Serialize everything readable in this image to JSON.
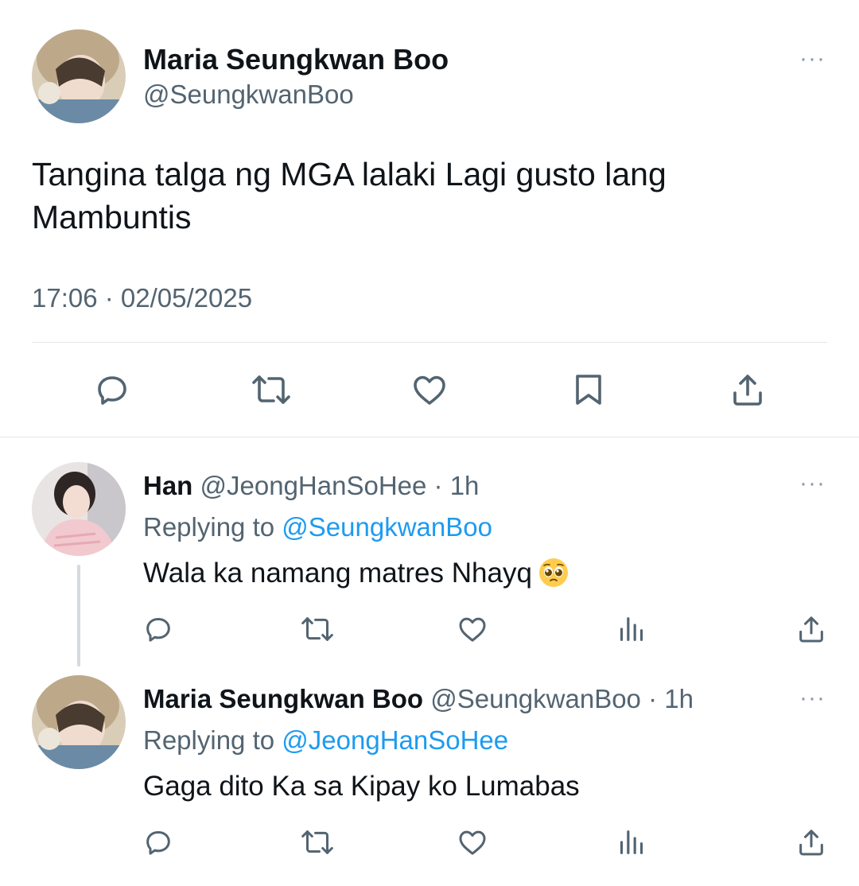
{
  "main_tweet": {
    "author_name": "Maria Seungkwan Boo",
    "author_handle": "@SeungkwanBoo",
    "text_line1": "Tangina talga ng MGA lalaki Lagi gusto lang",
    "text_line2": "Mambuntis",
    "timestamp": "17:06 · 02/05/2025",
    "more": "···",
    "actions": [
      "reply-icon",
      "retweet-icon",
      "like-icon",
      "bookmark-icon",
      "share-icon"
    ]
  },
  "replies": [
    {
      "author_name": "Han",
      "author_handle": "@JeongHanSoHee",
      "time": "· 1h",
      "replying_prefix": "Replying to",
      "replying_to": "@SeungkwanBoo",
      "text": "Wala ka namang matres Nhayq",
      "emoji": "pleading-face-emoji",
      "more": "···",
      "actions": [
        "reply-icon",
        "retweet-icon",
        "like-icon",
        "views-icon",
        "share-icon"
      ]
    },
    {
      "author_name": "Maria Seungkwan Boo",
      "author_handle": "@SeungkwanBoo",
      "time": "· 1h",
      "replying_prefix": "Replying to",
      "replying_to": "@JeongHanSoHee",
      "text": "Gaga dito Ka sa Kipay ko Lumabas",
      "more": "···",
      "actions": [
        "reply-icon",
        "retweet-icon",
        "like-icon",
        "views-icon",
        "share-icon"
      ]
    }
  ],
  "colors": {
    "text": "#0f1419",
    "secondary": "#536471",
    "link": "#1d9bf0",
    "icon": "#536471",
    "divider": "#e1e6ea"
  }
}
